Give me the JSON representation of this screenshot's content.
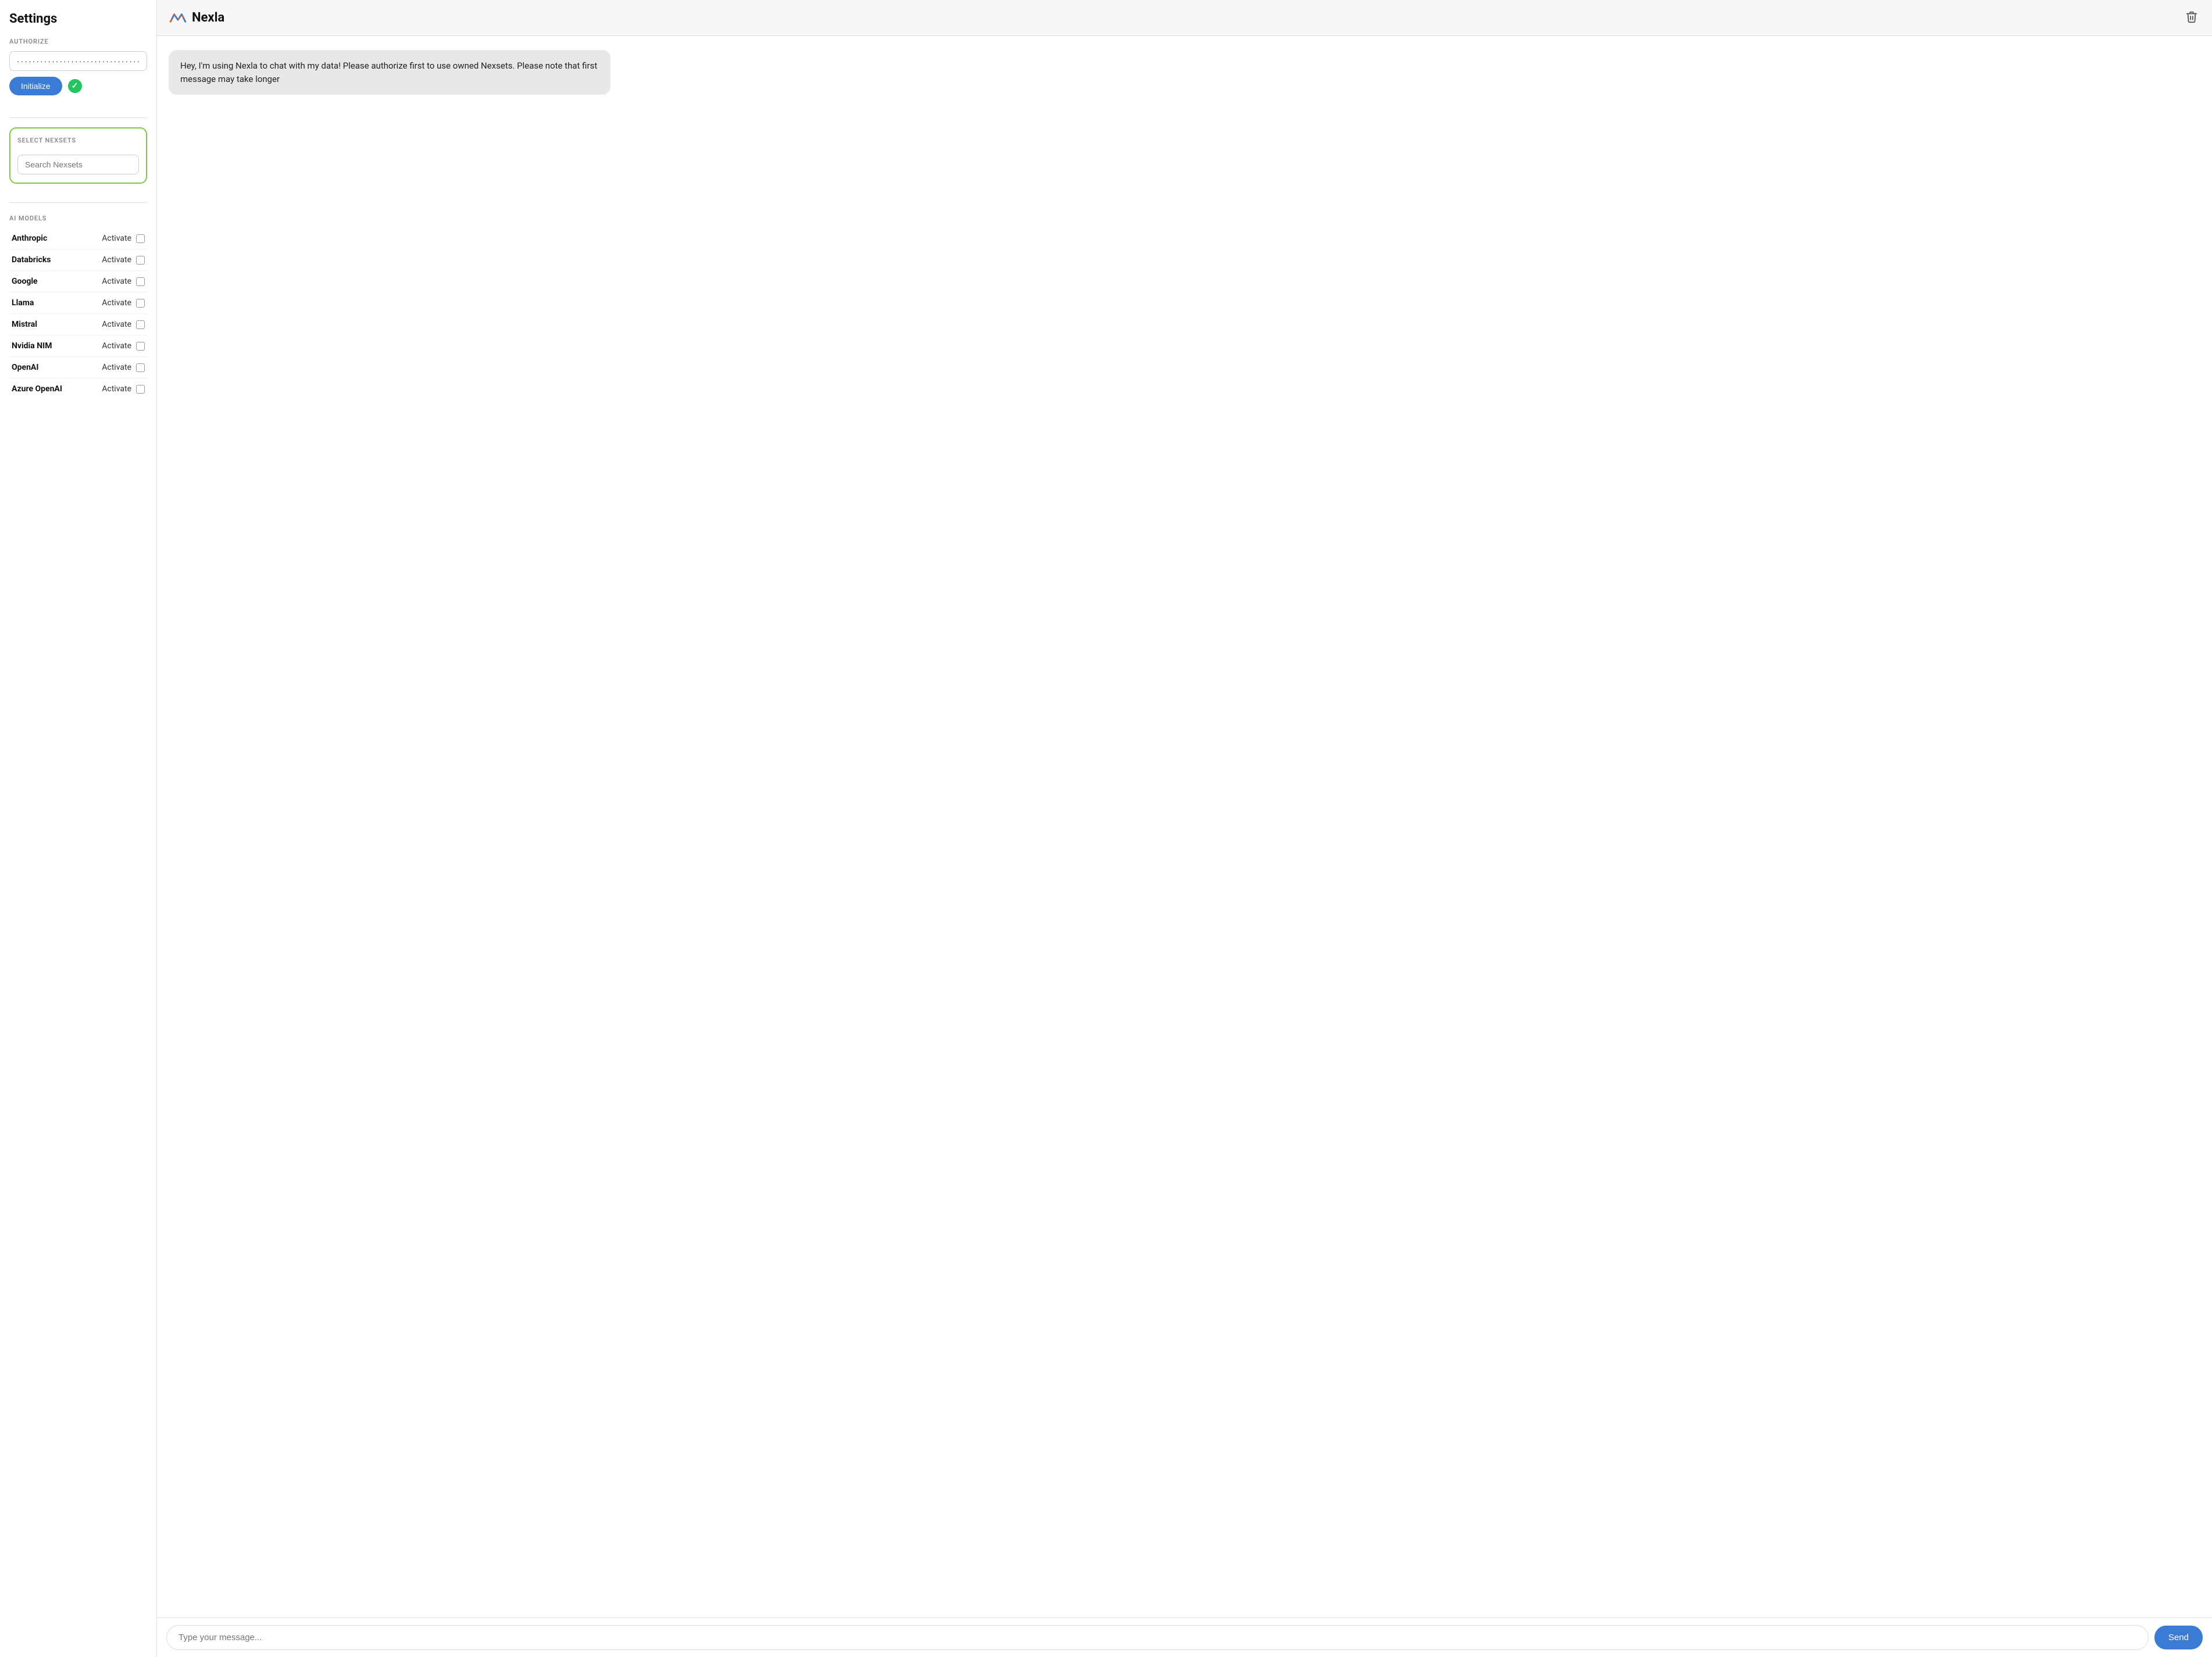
{
  "sidebar": {
    "title": "Settings",
    "authorize_label": "AUTHORIZE",
    "api_key_value": "························································",
    "initialize_label": "Initialize",
    "select_nexsets_label": "SELECT NEXSETS",
    "nexsets_search_placeholder": "Search Nexsets",
    "ai_models_label": "AI MODELS",
    "models": [
      {
        "name": "Anthropic",
        "activate_label": "Activate",
        "checked": false
      },
      {
        "name": "Databricks",
        "activate_label": "Activate",
        "checked": false
      },
      {
        "name": "Google",
        "activate_label": "Activate",
        "checked": false
      },
      {
        "name": "Llama",
        "activate_label": "Activate",
        "checked": false
      },
      {
        "name": "Mistral",
        "activate_label": "Activate",
        "checked": false
      },
      {
        "name": "Nvidia NIM",
        "activate_label": "Activate",
        "checked": false
      },
      {
        "name": "OpenAI",
        "activate_label": "Activate",
        "checked": false
      },
      {
        "name": "Azure OpenAI",
        "activate_label": "Activate",
        "checked": false
      }
    ]
  },
  "header": {
    "logo_name": "Nexla",
    "trash_icon": "trash-icon"
  },
  "chat": {
    "welcome_message": "Hey, I'm using Nexla to chat with my data! Please authorize first to use owned Nexsets. Please note that first message may take longer",
    "input_placeholder": "Type your message...",
    "send_label": "Send"
  }
}
